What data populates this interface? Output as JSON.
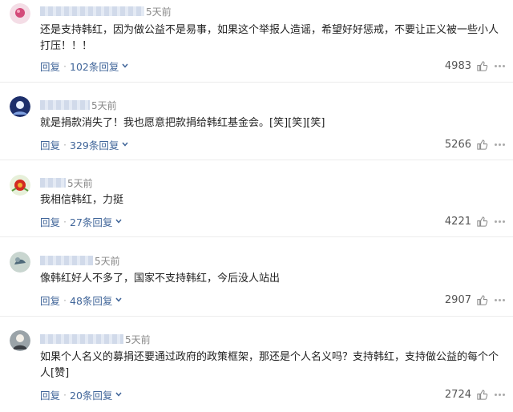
{
  "comments": [
    {
      "time": "5天前",
      "text": "还是支持韩红，因为做公益不是易事，如果这个举报人造谣，希望好好惩戒，不要让正义被一些小人打压！！！",
      "reply_label": "回复",
      "replies_label": "102条回复",
      "likes": "4983",
      "avatar": {
        "bg": "#f4dde6",
        "fg": "#d34b7a"
      }
    },
    {
      "time": "5天前",
      "text": "就是捐款消失了！我也愿意把款捐给韩红基金会。[笑][笑][笑]",
      "reply_label": "回复",
      "replies_label": "329条回复",
      "likes": "5266",
      "avatar": {
        "bg": "#1d2f6b",
        "fg": "#e8f0ff"
      }
    },
    {
      "time": "5天前",
      "text": "我相信韩红，力挺",
      "reply_label": "回复",
      "replies_label": "27条回复",
      "likes": "4221",
      "avatar": {
        "bg": "#e7f0da",
        "fg": "#d22a20"
      }
    },
    {
      "time": "5天前",
      "text": "像韩红好人不多了，国家不支持韩红，今后没人站出",
      "reply_label": "回复",
      "replies_label": "48条回复",
      "likes": "2907",
      "avatar": {
        "bg": "#c9d6d0",
        "fg": "#4f6a7a"
      }
    },
    {
      "time": "5天前",
      "text": "如果个人名义的募捐还要通过政府的政策框架，那还是个人名义吗？支持韩红，支持做公益的每个个人[赞]",
      "reply_label": "回复",
      "replies_label": "20条回复",
      "likes": "2724",
      "avatar": {
        "bg": "#9aa3a8",
        "fg": "#f3efe8"
      }
    }
  ],
  "colors": {
    "link": "#406599",
    "divider": "#ececec",
    "text": "#222222",
    "meta": "#999999"
  },
  "icons": {
    "like": "thumbs-up-icon",
    "more": "more-dots-icon",
    "expand": "chevron-down-icon"
  }
}
